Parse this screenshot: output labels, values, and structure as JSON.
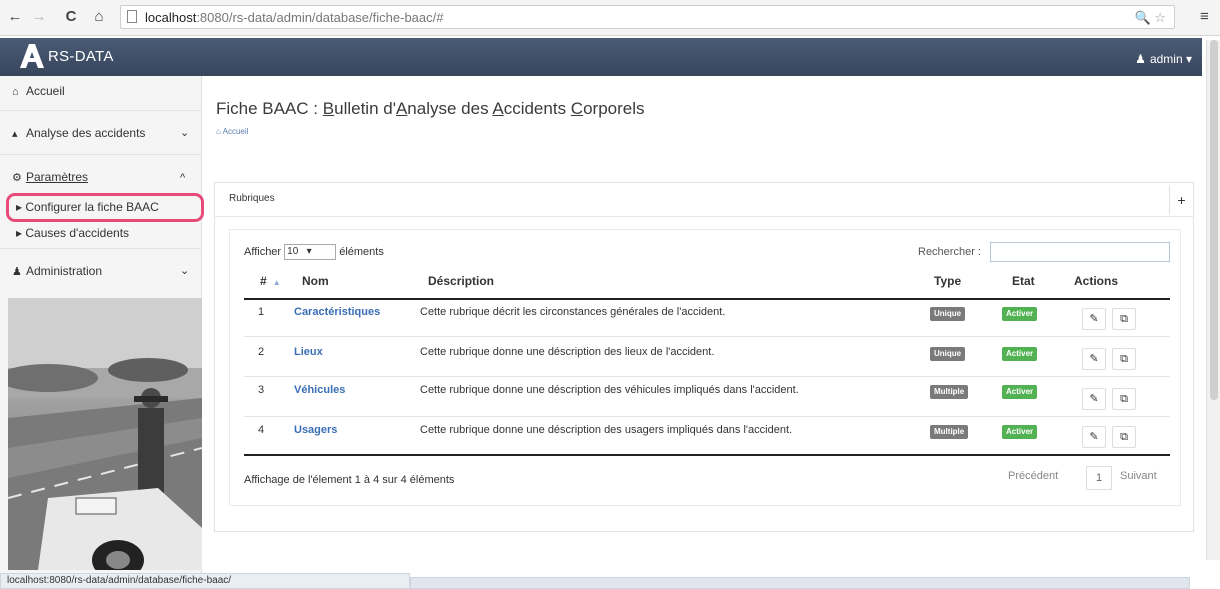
{
  "browser": {
    "url_host": "localhost",
    "url_rest": ":8080/rs-data/admin/database/fiche-baac/#",
    "back_glyph": "←",
    "forward_glyph": "→",
    "reload_glyph": "C",
    "home_glyph": "⌂",
    "menu_glyph": "≡",
    "right_icons": "🔍 ☆"
  },
  "navbar": {
    "brand": "RS-DATA",
    "user": "admin"
  },
  "sidebar": {
    "items": [
      {
        "label": "Accueil",
        "icon": "home-icon"
      },
      {
        "label": "Analyse des accidents",
        "icon": "chart-icon",
        "chevron": "⌄"
      },
      {
        "label": "Paramètres",
        "icon": "cogs-icon",
        "chevron": "^"
      },
      {
        "label": "Administration",
        "icon": "users-icon",
        "chevron": "⌄"
      }
    ],
    "sub_items": [
      {
        "label": "Configurer la fiche BAAC"
      },
      {
        "label": "Causes d'accidents"
      }
    ]
  },
  "page": {
    "title_prefix": "Fiche BAAC : ",
    "title_b": "B",
    "title_b_rest": "ulletin d'",
    "title_a": "A",
    "title_a_rest": "nalyse des ",
    "title_ac": "A",
    "title_ac_rest": "ccidents ",
    "title_c": "C",
    "title_c_rest": "orporels",
    "breadcrumb": "Accueil"
  },
  "panel": {
    "title": "Rubriques",
    "add_glyph": "+"
  },
  "table": {
    "length_prefix": "Afficher",
    "length_value": "10",
    "length_suffix": "éléments",
    "search_label": "Rechercher :",
    "headers": {
      "num": "#",
      "nom": "Nom",
      "description": "Déscription",
      "type": "Type",
      "etat": "Etat",
      "actions": "Actions"
    },
    "rows": [
      {
        "num": "1",
        "nom": "Caractéristiques",
        "description": "Cette rubrique décrit les circonstances générales de l'accident.",
        "type": "Unique",
        "etat": "Activer"
      },
      {
        "num": "2",
        "nom": "Lieux",
        "description": "Cette rubrique donne une déscription des lieux de l'accident.",
        "type": "Unique",
        "etat": "Activer"
      },
      {
        "num": "3",
        "nom": "Véhicules",
        "description": "Cette rubrique donne une déscription des véhicules impliqués dans l'accident.",
        "type": "Multiple",
        "etat": "Activer"
      },
      {
        "num": "4",
        "nom": "Usagers",
        "description": "Cette rubrique donne une déscription des usagers impliqués dans l'accident.",
        "type": "Multiple",
        "etat": "Activer"
      }
    ],
    "info": "Affichage de l'élement 1 à 4 sur 4 éléments",
    "prev": "Précédent",
    "current_page": "1",
    "next": "Suivant"
  },
  "status_bar": "localhost:8080/rs-data/admin/database/fiche-baac/"
}
